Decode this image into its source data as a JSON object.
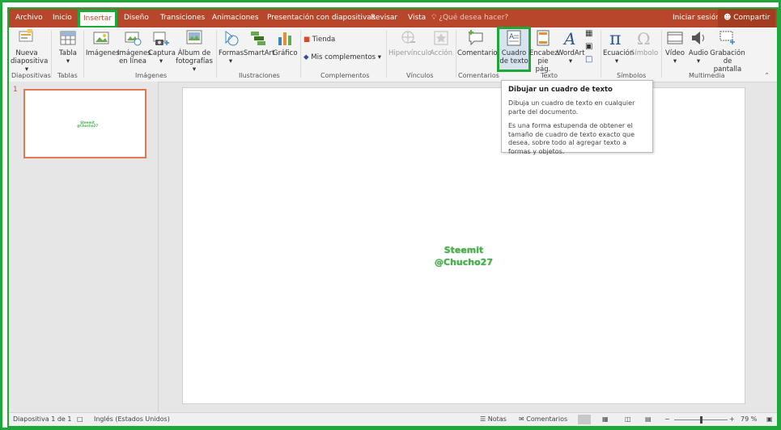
{
  "menu": {
    "tabs": [
      "Archivo",
      "Inicio",
      "Insertar",
      "Diseño",
      "Transiciones",
      "Animaciones",
      "Presentación con diapositivas",
      "Revisar",
      "Vista"
    ],
    "active_tab": "Insertar",
    "tell_me": "¿Qué desea hacer?",
    "sign_in": "Iniciar sesión",
    "share": "Compartir"
  },
  "ribbon": {
    "new_slide": [
      "Nueva",
      "diapositiva ▾"
    ],
    "table": [
      "Tabla",
      "▾"
    ],
    "images": [
      "Imágenes",
      ""
    ],
    "online_images": [
      "Imágenes",
      "en línea"
    ],
    "capture": [
      "Captura",
      "▾"
    ],
    "album": [
      "Álbum de",
      "fotografías ▾"
    ],
    "shapes": [
      "Formas",
      "▾"
    ],
    "smartart": "SmartArt",
    "chart": "Gráfico",
    "store": "Tienda",
    "my_addins": "Mis complementos",
    "hyperlink": "Hipervínculo",
    "action": "Acción",
    "comment": "Comentario",
    "textbox": [
      "Cuadro",
      "de texto"
    ],
    "header": [
      "Encabez.",
      "pie pág."
    ],
    "wordart": [
      "WordArt",
      "▾"
    ],
    "equation": [
      "Ecuación",
      "▾"
    ],
    "symbol": "Símbolo",
    "video": [
      "Vídeo",
      "▾"
    ],
    "audio": [
      "Audio",
      "▾"
    ],
    "screen_recording": [
      "Grabación",
      "de pantalla"
    ],
    "groups": [
      "Diapositivas",
      "Tablas",
      "Imágenes",
      "Ilustraciones",
      "Complementos",
      "Vínculos",
      "Comentarios",
      "Texto",
      "Símbolos",
      "Multimedia"
    ]
  },
  "tooltip": {
    "title": "Dibujar un cuadro de texto",
    "line1": "Dibuja un cuadro de texto en cualquier parte del documento.",
    "line2": "Es una forma estupenda de obtener el tamaño de cuadro de texto exacto que desea, sobre todo al agregar texto a formas y objetos."
  },
  "thumbnails": {
    "number": "1"
  },
  "slide": {
    "line1": "Steemit",
    "line2": "@Chucho27"
  },
  "status": {
    "slide_info": "Diapositiva 1 de 1",
    "language": "Inglés (Estados Unidos)",
    "notes": "Notas",
    "comments": "Comentarios",
    "zoom": "79 %",
    "zoom_level": 0.5
  },
  "colors": {
    "accent": "#b7472a",
    "highlight": "#1fa83a",
    "thumb_border": "#e07850",
    "slide_text": "#4caf50"
  }
}
